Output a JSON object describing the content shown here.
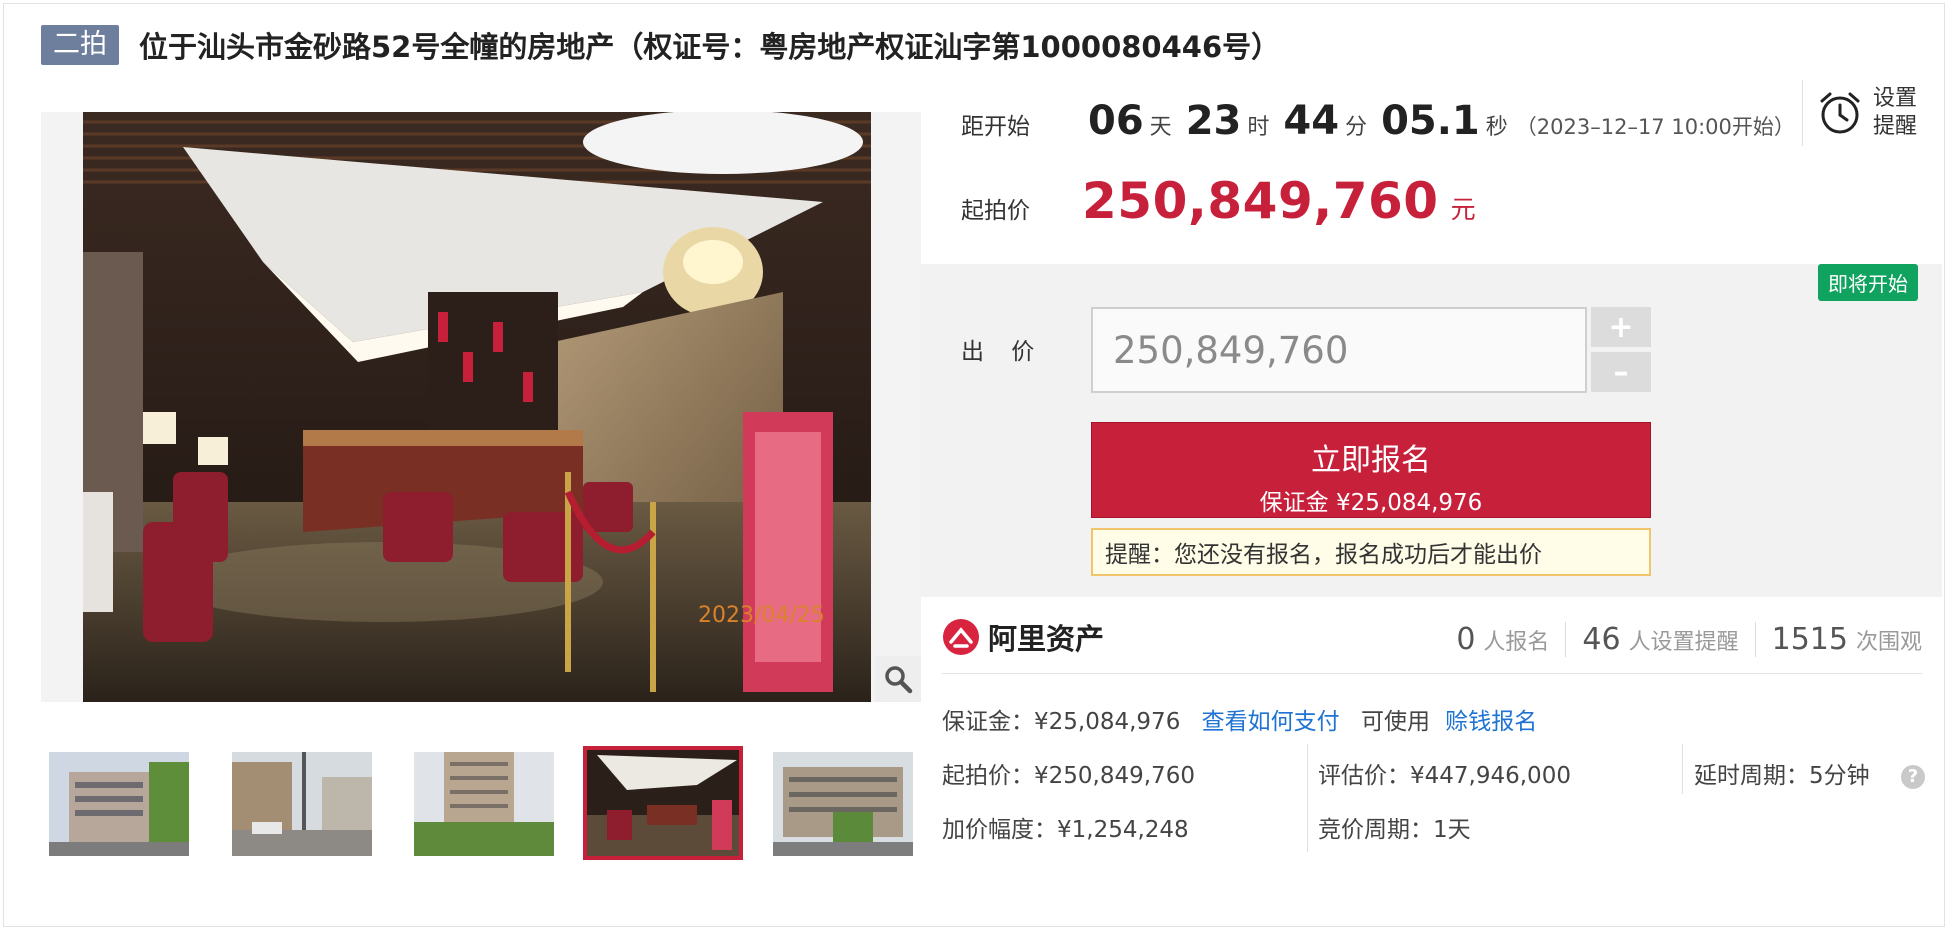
{
  "title": {
    "badge": "二拍",
    "text": "位于汕头市金砂路52号全幢的房地产（权证号：粤房地产权证汕字第1000080446号）"
  },
  "gallery": {
    "photo_watermark": "2023/04/25",
    "zoom_icon": "magnifier-icon",
    "thumbnail_count": 5,
    "active_thumbnail": 4
  },
  "countdown": {
    "label": "距开始",
    "days": "06",
    "days_unit": "天",
    "hours": "23",
    "hours_unit": "时",
    "minutes": "44",
    "minutes_unit": "分",
    "seconds": "05.1",
    "seconds_unit": "秒",
    "start_time": "（2023–12–17 10:00开始）"
  },
  "reminder": {
    "icon": "alarm-clock-icon",
    "label": "设置提醒"
  },
  "start_price": {
    "label": "起拍价",
    "value": "250,849,760",
    "unit": "元"
  },
  "bid": {
    "status_tag": "即将开始",
    "label": "出 价",
    "input_value": "250,849,760",
    "plus": "+",
    "minus": "–",
    "signup_label": "立即报名",
    "deposit_line": "保证金 ¥25,084,976",
    "notice": "提醒：您还没有报名，报名成功后才能出价"
  },
  "platform": {
    "logo_icon": "ali-assets-logo-icon",
    "name": "阿里资产",
    "stats": [
      {
        "value": "0",
        "label": "人报名"
      },
      {
        "value": "46",
        "label": "人设置提醒"
      },
      {
        "value": "1515",
        "label": "次围观"
      }
    ]
  },
  "details": {
    "deposit": "保证金：¥25,084,976",
    "how_to_pay_link": "查看如何支付",
    "usable_text": "可使用",
    "earn_link": "赊钱报名",
    "start_price": "起拍价：¥250,849,760",
    "appraisal": "评估价：¥447,946,000",
    "delay_period": "延时周期：5分钟",
    "increment": "加价幅度：¥1,254,248",
    "bidding_period": "竞价周期：1天",
    "help_icon": "question-icon"
  },
  "colors": {
    "accent_red": "#c7203a",
    "badge_blue_gray": "#6e7f9e",
    "status_green": "#10a35f",
    "link_blue": "#1e73d3"
  }
}
